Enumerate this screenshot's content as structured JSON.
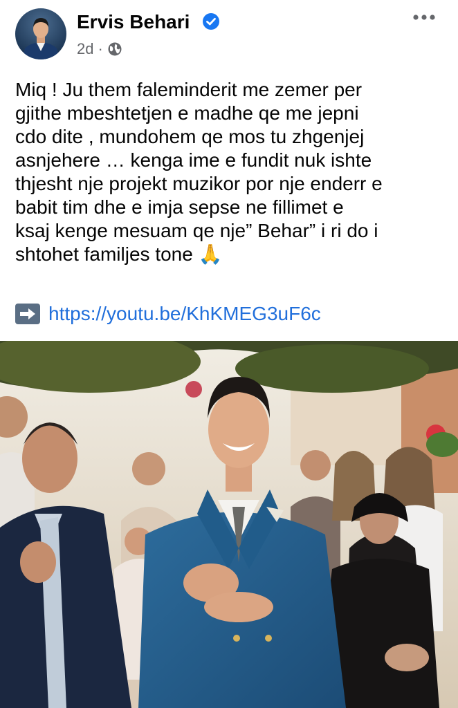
{
  "post": {
    "author": "Ervis Behari",
    "time": "2d",
    "separator": "·",
    "text_lines": [
      "Miq ! Ju them faleminderit me zemer per",
      "gjithe mbeshtetjen e madhe qe me jepni",
      "cdo dite , mundohem qe mos tu zhgenjej",
      "asnjehere … kenga ime e fundit nuk ishte",
      "thjesht nje projekt muzikor por nje enderr e",
      "babit tim dhe e imja  sepse ne fillimet e",
      "ksaj kenge mesuam qe nje” Behar” i ri  do i",
      "shtohet familjes tone 🙏"
    ],
    "link": "https://youtu.be/KhKMEG3uF6c",
    "icons": {
      "verified": "verified-badge-icon",
      "privacy": "globe-icon",
      "more": "more-options-icon",
      "link_arrow": "right-arrow-icon",
      "praying": "folded-hands-emoji"
    },
    "colors": {
      "link": "#216fdb",
      "meta": "#65676b",
      "verified": "#1877f2"
    }
  }
}
